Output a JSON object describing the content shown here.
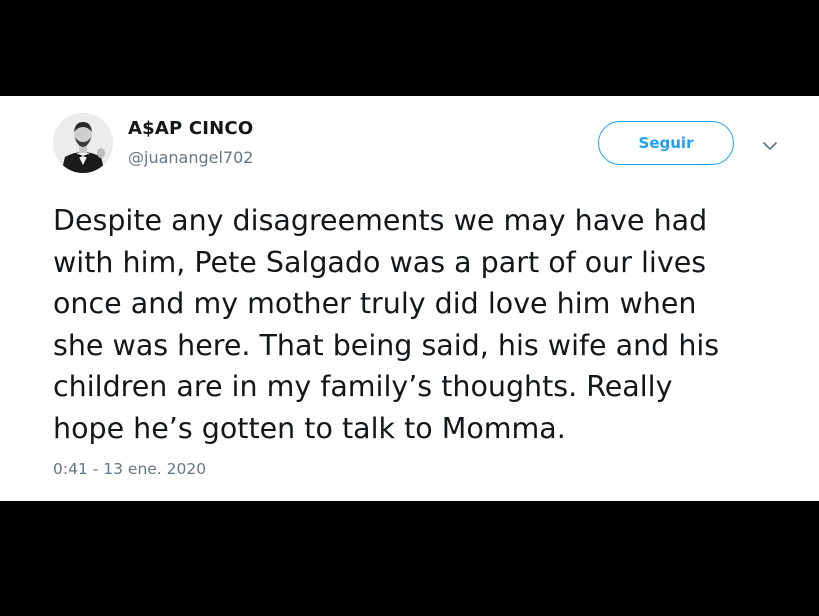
{
  "tweet": {
    "author": {
      "display_name": "A$AP CINCO",
      "handle": "@juanangel702"
    },
    "follow_label": "Seguir",
    "text_lines": [
      "Despite any disagreements we may have had",
      "with him, Pete Salgado was a part of our lives",
      "once and my mother truly did love him when",
      "she was here. That being said, his wife and his",
      "children are in my family’s thoughts. Really",
      "hope he’s gotten to talk to Momma."
    ],
    "timestamp": "0:41 - 13 ene. 2020"
  },
  "icons": {
    "avatar": "profile-photo",
    "more": "chevron-down-icon"
  },
  "colors": {
    "accent": "#1da1f2",
    "text_primary": "#14171a",
    "text_secondary": "#657786",
    "background_outer": "#000000",
    "card_background": "#ffffff"
  }
}
